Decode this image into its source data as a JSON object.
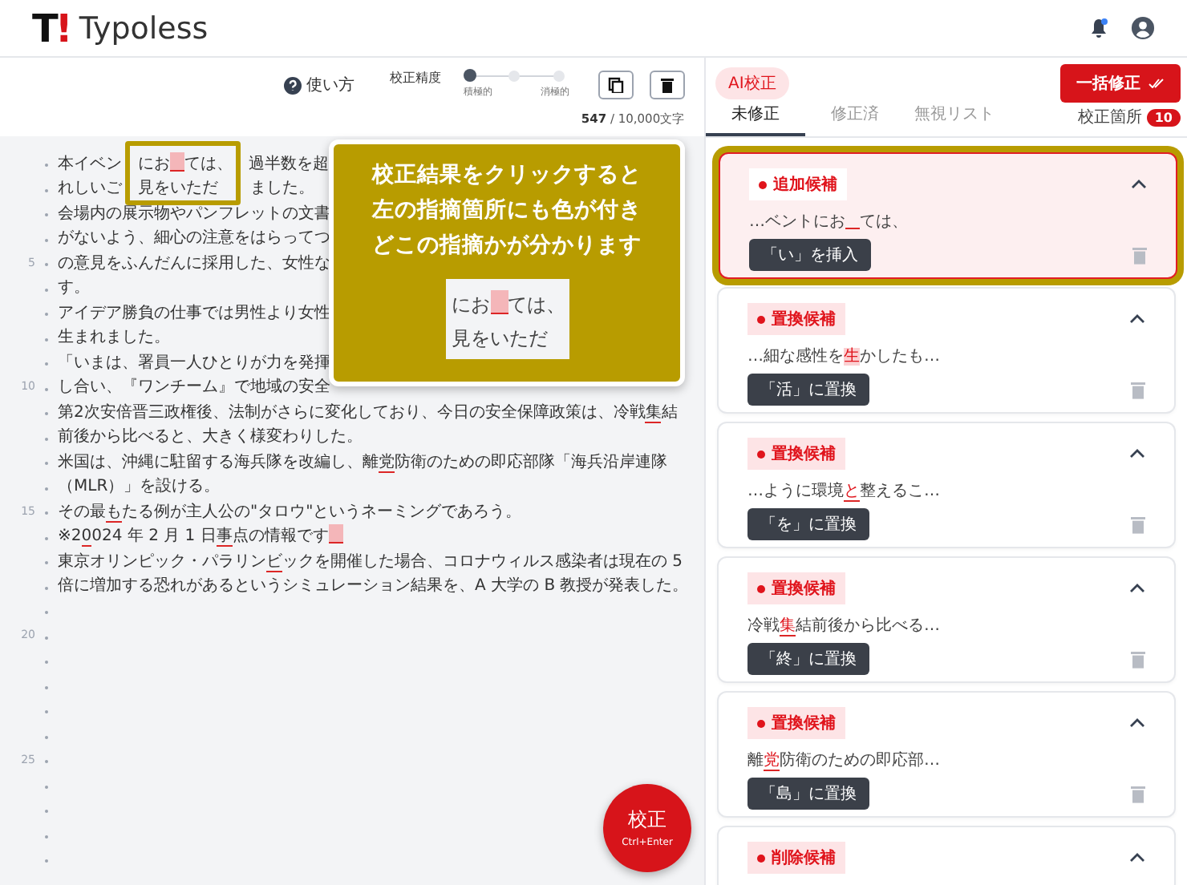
{
  "app": {
    "logo_mark": "T!",
    "logo_text": "Typoless"
  },
  "toolbar": {
    "help": "使い方",
    "precision": {
      "label": "校正精度",
      "level": 0,
      "min_label": "積極的",
      "max_label": "消極的"
    },
    "count": "547",
    "limit": " / 10,000文字"
  },
  "editor": {
    "lines": [
      {
        "segments": [
          {
            "kind": "text",
            "text": "本イベン　にお"
          },
          {
            "kind": "gap"
          },
          {
            "kind": "text",
            "text": "ては、　過半数を超"
          }
        ]
      },
      {
        "segments": [
          {
            "kind": "text",
            "text": "れしいご　見をいただ　　ました。"
          }
        ]
      },
      {
        "segments": [
          {
            "kind": "text",
            "text": "会場内の展示物やパンフレットの文書"
          }
        ]
      },
      {
        "segments": [
          {
            "kind": "text",
            "text": "がないよう、細心の注意をはらってつ"
          }
        ]
      },
      {
        "segments": [
          {
            "kind": "text",
            "text": "の意見をふんだんに採用した、女性な"
          }
        ]
      },
      {
        "segments": [
          {
            "kind": "text",
            "text": "す。"
          }
        ]
      },
      {
        "segments": [
          {
            "kind": "text",
            "text": "アイデア勝負の仕事では男性より女性"
          }
        ]
      },
      {
        "segments": [
          {
            "kind": "text",
            "text": "生まれました。"
          }
        ]
      },
      {
        "segments": [
          {
            "kind": "text",
            "text": "「いまは、署員一人ひとりが力を発揮"
          }
        ]
      },
      {
        "segments": [
          {
            "kind": "text",
            "text": "し合い、『ワンチーム』で地域の安全"
          }
        ]
      },
      {
        "segments": [
          {
            "kind": "text",
            "text": "第2次安倍晋三政権後、法制がさらに変化しており、今日の安全保障政策は、冷戦"
          },
          {
            "kind": "error",
            "text": "集"
          },
          {
            "kind": "text",
            "text": "結"
          }
        ]
      },
      {
        "segments": [
          {
            "kind": "text",
            "text": "前後から比べると、大きく様変わりした。"
          }
        ]
      },
      {
        "segments": [
          {
            "kind": "text",
            "text": "米国は、沖縄に駐留する海兵隊を改編し、離"
          },
          {
            "kind": "error",
            "text": "党"
          },
          {
            "kind": "text",
            "text": "防衛のための即応部隊「海兵沿岸連隊"
          }
        ]
      },
      {
        "segments": [
          {
            "kind": "text",
            "text": "（MLR）」を設ける。"
          }
        ]
      },
      {
        "segments": [
          {
            "kind": "text",
            "text": "その最"
          },
          {
            "kind": "error",
            "text": "も"
          },
          {
            "kind": "text",
            "text": "たる例が主人公の\"タロウ\"というネーミングであろう。"
          }
        ]
      },
      {
        "segments": [
          {
            "kind": "text",
            "text": "※2"
          },
          {
            "kind": "error",
            "text": "0"
          },
          {
            "kind": "text",
            "text": "024 年 2 月 1 日"
          },
          {
            "kind": "error",
            "text": "事"
          },
          {
            "kind": "text",
            "text": "点の情報です"
          },
          {
            "kind": "gap"
          }
        ]
      },
      {
        "segments": [
          {
            "kind": "text",
            "text": "東京オリンピック・パラリン"
          },
          {
            "kind": "error",
            "text": "ビ"
          },
          {
            "kind": "text",
            "text": "ックを開催した場合、コロナウィルス感染者は現在の 5"
          }
        ]
      },
      {
        "segments": [
          {
            "kind": "text",
            "text": "倍に増加する恐れがあるというシミュレーション結果を、A 大学の B 教授が発表した。"
          }
        ]
      }
    ],
    "line_numbers": [
      "5",
      "10",
      "15",
      "20",
      "25"
    ],
    "callout": {
      "lines": [
        "校正結果をクリックすると",
        "左の指摘箇所にも色が付き",
        "どこの指摘かが分かります"
      ],
      "preview": [
        {
          "before": "にお",
          "after": "ては、"
        },
        {
          "before": "見をいただ"
        }
      ]
    },
    "proofread_button": {
      "label": "校正",
      "shortcut": "Ctrl+Enter"
    }
  },
  "results": {
    "ai_label": "AI校正",
    "fix_all": "一括修正",
    "tabs": [
      {
        "label": "未修正",
        "selected": true
      },
      {
        "label": "修正済",
        "selected": false
      },
      {
        "label": "無視リスト",
        "selected": false
      }
    ],
    "count_label": "校正箇所",
    "count": "10",
    "cards": [
      {
        "kind": "insert",
        "badge": "追加候補",
        "selected": true,
        "before": "…ベントにお",
        "after": "ては、",
        "action": "「い」を挿入"
      },
      {
        "kind": "replace",
        "badge": "置換候補",
        "selected": false,
        "before": "…細な感性を",
        "target": "生",
        "after": "かしたも…",
        "action": "「活」に置換"
      },
      {
        "kind": "replace",
        "badge": "置換候補",
        "selected": false,
        "before": "…ように環境",
        "target": "と",
        "after": "整えるこ…",
        "action": "「を」に置換"
      },
      {
        "kind": "replace",
        "badge": "置換候補",
        "selected": false,
        "before": "冷戦",
        "target": "集",
        "after": "結前後から比べる…",
        "action": "「終」に置換"
      },
      {
        "kind": "replace",
        "badge": "置換候補",
        "selected": false,
        "before": "離",
        "target": "党",
        "after": "防衛のための即応部…",
        "action": "「島」に置換"
      },
      {
        "kind": "delete",
        "badge": "削除候補",
        "selected": false
      }
    ]
  }
}
